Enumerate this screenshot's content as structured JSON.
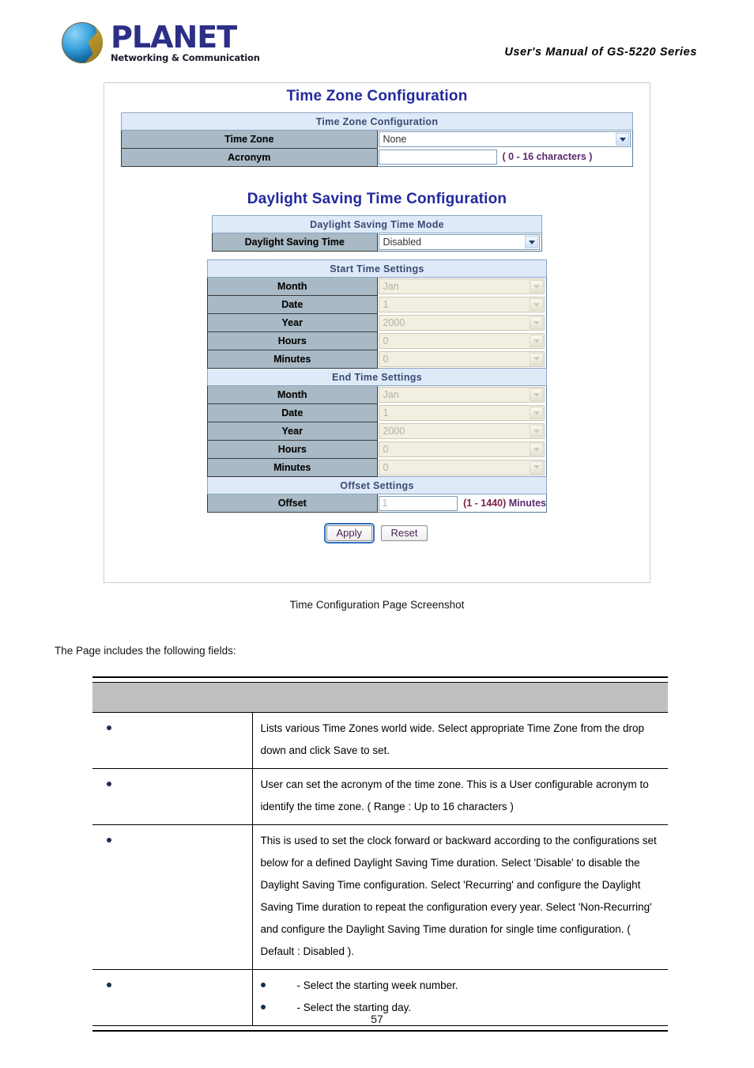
{
  "header": {
    "logo_word": "PLANET",
    "logo_tagline": "Networking & Communication",
    "manual_title": "User's Manual of GS-5220 Series"
  },
  "screenshot": {
    "caption": "Time Configuration Page Screenshot",
    "time_zone_section": {
      "heading": "Time Zone Configuration",
      "table_title": "Time Zone Configuration",
      "rows": [
        {
          "label": "Time Zone",
          "value": "None",
          "control": "select",
          "disabled": false
        },
        {
          "label": "Acronym",
          "value": "",
          "control": "text",
          "disabled": false,
          "hint": "( 0 - 16 characters )"
        }
      ]
    },
    "dst_section": {
      "heading": "Daylight Saving Time Configuration",
      "mode_table_title": "Daylight Saving Time Mode",
      "mode_label": "Daylight Saving Time",
      "mode_value": "Disabled",
      "start_title": "Start Time Settings",
      "start_rows": [
        {
          "label": "Month",
          "value": "Jan"
        },
        {
          "label": "Date",
          "value": "1"
        },
        {
          "label": "Year",
          "value": "2000"
        },
        {
          "label": "Hours",
          "value": "0"
        },
        {
          "label": "Minutes",
          "value": "0"
        }
      ],
      "end_title": "End Time Settings",
      "end_rows": [
        {
          "label": "Month",
          "value": "Jan"
        },
        {
          "label": "Date",
          "value": "1"
        },
        {
          "label": "Year",
          "value": "2000"
        },
        {
          "label": "Hours",
          "value": "0"
        },
        {
          "label": "Minutes",
          "value": "0"
        }
      ],
      "offset_title": "Offset Settings",
      "offset_label": "Offset",
      "offset_value": "1",
      "offset_hint_range": "(1 - 1440)",
      "offset_hint_unit": "Minutes"
    },
    "buttons": {
      "apply": "Apply",
      "reset": "Reset"
    }
  },
  "body": {
    "lead_text": "The Page includes the following fields:",
    "fields_table": {
      "headers": {
        "col1": "",
        "col2": ""
      },
      "rows": [
        {
          "label": "",
          "description": "Lists various Time Zones world wide. Select appropriate Time Zone from the drop down and click Save to set."
        },
        {
          "label": "",
          "description": "User can set the acronym of the time zone. This is a User configurable acronym to identify the time zone. ( Range : Up to 16 characters )"
        },
        {
          "label": "",
          "description": "This is used to set the clock forward or backward according to the configurations set below for a defined Daylight Saving Time duration. Select 'Disable' to disable the Daylight Saving Time configuration. Select 'Recurring' and configure the Daylight Saving Time duration to repeat the configuration every year. Select 'Non-Recurring' and configure the Daylight Saving Time duration for single time configuration. ( Default : Disabled )."
        },
        {
          "label": "",
          "sub_items": [
            "- Select the starting week number.",
            "- Select the starting day."
          ]
        }
      ]
    }
  },
  "footer": {
    "page_number": "57"
  }
}
